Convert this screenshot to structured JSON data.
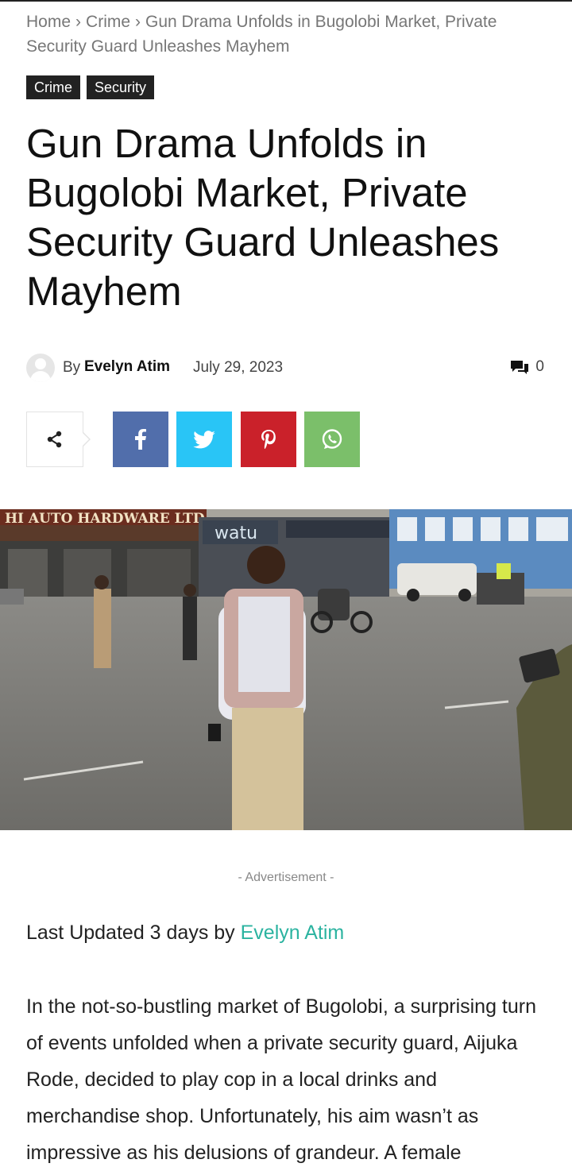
{
  "breadcrumb": {
    "home": "Home",
    "separator": "›",
    "category": "Crime",
    "current": "Gun Drama Unfolds in Bugolobi Market, Private Security Guard Unleashes Mayhem"
  },
  "tags": [
    "Crime",
    "Security"
  ],
  "article": {
    "title": "Gun Drama Unfolds in Bugolobi Market, Private Security Guard Unleashes Mayhem",
    "by_label": "By",
    "author": "Evelyn Atim",
    "date": "July 29, 2023",
    "comment_count": "0"
  },
  "photo": {
    "shop_sign": "HI AUTO HARDWARE LTD",
    "brand_sign": "watu"
  },
  "advertisement_label": "- Advertisement -",
  "updated": {
    "prefix": "Last Updated 3 days by",
    "author": "Evelyn Atim"
  },
  "body": "In the not-so-bustling market of Bugolobi, a surprising turn of events unfolded when a private security guard, Aijuka Rode, decided to play cop in a local drinks and merchandise shop. Unfortunately, his aim wasn’t as impressive as his delusions of grandeur. A female",
  "colors": {
    "facebook": "#516eab",
    "twitter": "#29c5f6",
    "pinterest": "#ca212a",
    "whatsapp": "#7bbf6a",
    "link": "#2bb3a0"
  },
  "icons": [
    "share-icon",
    "facebook-icon",
    "twitter-icon",
    "pinterest-icon",
    "whatsapp-icon",
    "comment-icon",
    "avatar-icon"
  ]
}
